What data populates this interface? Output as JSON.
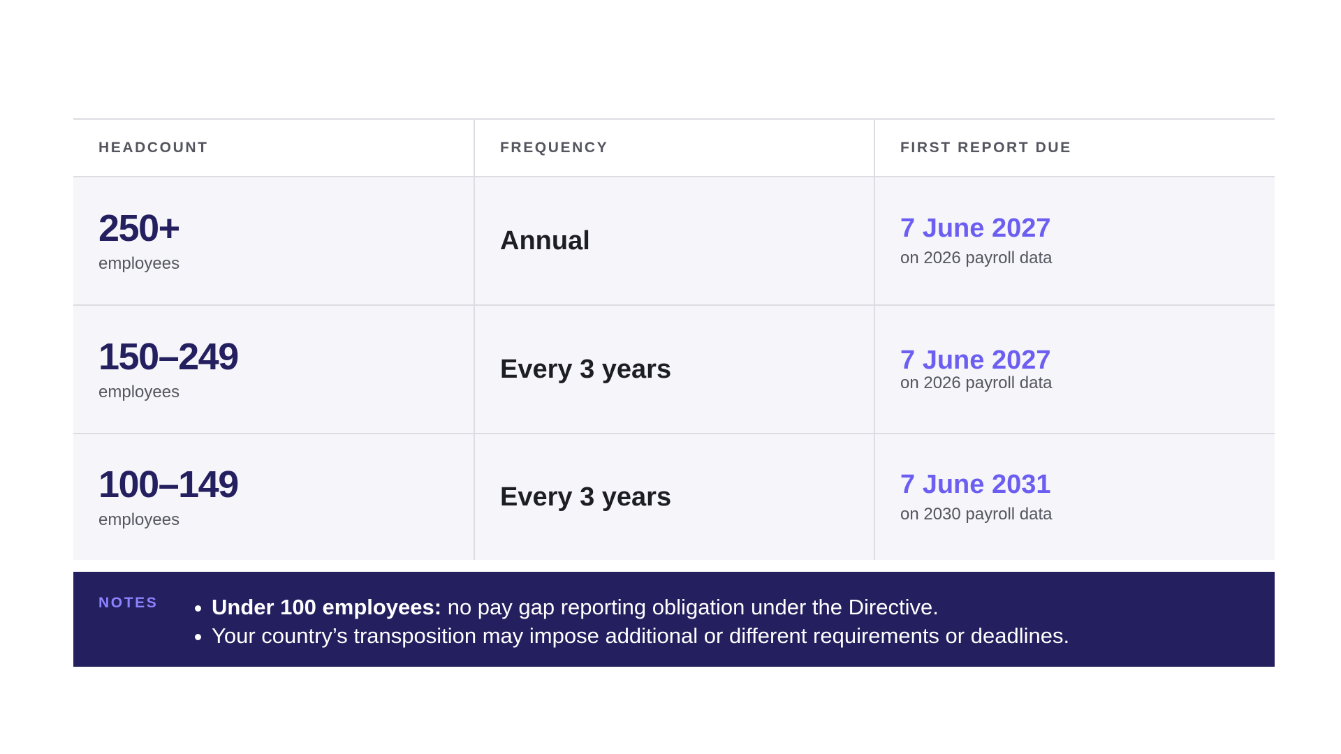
{
  "table": {
    "headers": [
      "HEADCOUNT",
      "FREQUENCY",
      "FIRST REPORT DUE"
    ],
    "rows": [
      {
        "headcount": "250+",
        "headcount_unit": "employees",
        "frequency": "Annual",
        "due_date": "7 June 2027",
        "due_basis": "on 2026 payroll data"
      },
      {
        "headcount": "150–249",
        "headcount_unit": "employees",
        "frequency": "Every 3 years",
        "due_date": "7 June 2027",
        "due_basis": "on 2026 payroll data"
      },
      {
        "headcount": "100–149",
        "headcount_unit": "employees",
        "frequency": "Every 3 years",
        "due_date": "7 June 2031",
        "due_basis": "on 2030 payroll data"
      }
    ]
  },
  "notes": {
    "label": "NOTES",
    "items": [
      {
        "bold": "Under 100 employees:",
        "text": " no pay gap reporting obligation under the Directive."
      },
      {
        "bold": "",
        "text": "Your country’s transposition may impose additional or different requirements or deadlines."
      }
    ]
  },
  "colors": {
    "accent": "#6b5ef0",
    "navy": "#241f5e",
    "row_background": "#f5f5fa",
    "notes_label": "#8d82ff"
  }
}
